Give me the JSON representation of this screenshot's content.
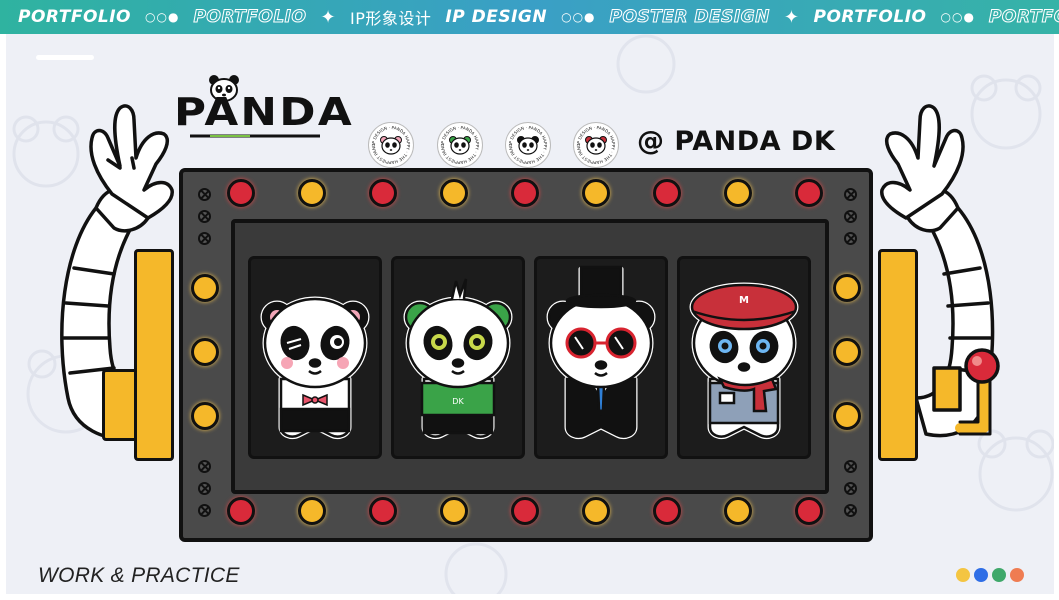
{
  "banner": {
    "items": [
      {
        "type": "solid",
        "text": "PORTFOLIO"
      },
      {
        "type": "dots",
        "text": "○○●"
      },
      {
        "type": "outline",
        "text": "PORTFOLIO"
      },
      {
        "type": "star",
        "text": "✦"
      },
      {
        "type": "plain",
        "text": "IP形象设计"
      },
      {
        "type": "solid",
        "text": "IP DESIGN"
      },
      {
        "type": "dots",
        "text": "○○●"
      },
      {
        "type": "outline",
        "text": "POSTER DESIGN"
      },
      {
        "type": "star",
        "text": "✦"
      },
      {
        "type": "solid",
        "text": "PORTFOLIO"
      },
      {
        "type": "dots",
        "text": "○○●"
      },
      {
        "type": "outline",
        "text": "PORTFOLIO"
      }
    ]
  },
  "header": {
    "logo_text": "PANDA",
    "handle": "@ PANDA DK",
    "badge_ring_text": "IP DESIGN · PANDA HAPPY · THE HAPPIEST PANDA ·"
  },
  "reels": [
    {
      "character": "pink-ears-winking-panda",
      "ear_color": "#f2a6b8",
      "accessory": "bowtie",
      "accent": "#e8546b"
    },
    {
      "character": "green-shirt-panda",
      "ear_color": "#56b35a",
      "accessory": "shirt",
      "accent": "#3aa348",
      "shirt_text": "DK"
    },
    {
      "character": "top-hat-gentleman-panda",
      "ear_color": "#111111",
      "accessory": "top-hat",
      "accent": "#d8232f"
    },
    {
      "character": "red-beret-scarf-panda",
      "ear_color": "#111111",
      "accessory": "beret",
      "accent": "#c8303a",
      "beret_text": "M"
    }
  ],
  "footer": {
    "tagline": "WORK & PRACTICE",
    "dots": [
      "#f4c542",
      "#2f6ee6",
      "#3fa86a",
      "#ef7c52"
    ]
  },
  "colors": {
    "machine_body": "#4a4a4a",
    "light_red": "#d92a3a",
    "light_yellow": "#f5b82a",
    "banner_gradient": [
      "#2fb3a0",
      "#3a9fc6"
    ]
  }
}
